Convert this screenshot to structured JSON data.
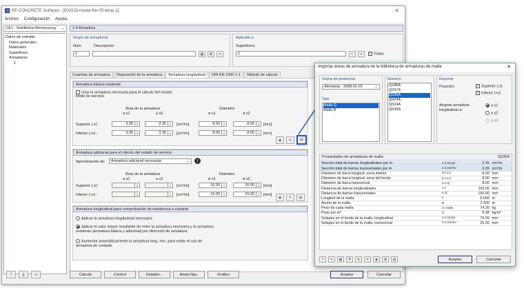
{
  "window": {
    "title": "RF-CONCRETE Surfaces - [001515-model-file-rf5-temp-1]",
    "menu": [
      "Archivo",
      "Configuración",
      "Ayuda"
    ],
    "case": "CA1 - Stahlbeton-Bemessung",
    "section_title": "1.4 Armadura"
  },
  "tree": {
    "root": "Datos de entrada",
    "items": [
      "Datos generales",
      "Materiales",
      "Superficies",
      "Armaduras",
      "1"
    ]
  },
  "groups": {
    "label": "Grupo de armaduras",
    "no_label": "Núm.",
    "desc_label": "Descripción:",
    "no_value": "1",
    "applied_label": "Aplicado a",
    "surfaces_label": "Superficies:",
    "surfaces_value": "1",
    "todas": "Todas"
  },
  "tabs": [
    "Cuantías de armadura",
    "Disposición de la armadura",
    "Armadura longitudinal",
    "DIN EN 1992-1-1",
    "Método de cálculo"
  ],
  "basic": {
    "header": "Armadura básica existente",
    "check_label": "Usar la armadura necesaria para el cálculo del estado límite de servicio",
    "area_header": "Área de la armadura",
    "diam_header": "Diámetro",
    "as1": "a s1",
    "as2": "a s2",
    "fs1": "ø s1",
    "fs2": "ø s2",
    "upper": "Superior (-z) :",
    "lower": "Inferior (+z) :",
    "area_unit": "[cm²/m]",
    "diam_unit": "[mm]",
    "upper_as1": "3.35",
    "upper_as2": "3.35",
    "lower_as1": "3.35",
    "lower_as2": "3.35",
    "upper_d1": "8.00",
    "upper_d2": "8.00",
    "lower_d1": "8.00",
    "lower_d2": "8.00"
  },
  "additional": {
    "header": "Armadura adicional para el cálculo del estado de servicio",
    "approx_label": "Aproximación de:",
    "approx_value": "Armadura adicional necesaria",
    "area_header": "Área de la armadura",
    "diam_header": "Diámetro",
    "as1": "a s1",
    "as2": "a s2",
    "fs1": "ø s1",
    "fs2": "ø s2",
    "upper": "Superior (-z) :",
    "lower": "Inferior (+z) :",
    "area_unit": "[cm²/m]",
    "diam_unit": "[mm]",
    "upper_d1": "16.00",
    "upper_d2": "16.00",
    "lower_d1": "16.00",
    "lower_d2": "16.00"
  },
  "shear": {
    "header": "Armadura longitudinal para comprobación de resistencia a cortante",
    "opt1": "Aplicar la armadura longitudinal necesaria",
    "opt2": "Aplicar el valor mayor resultante de entre la armadura necesaria y la armadura existente (armadura básica y adicional) por dirección de armadura",
    "opt3": "Aumentar automáticamente la armadura long. nec. para evitar el uso de armadura de cortante"
  },
  "bottom": {
    "calc": "Cálculo",
    "control": "Control",
    "details": "Detalles...",
    "annex": "Anejo Nac.",
    "graphic": "Gráfico",
    "accept": "Aceptar",
    "cancel": "Cancelar"
  },
  "dialog": {
    "title": "Importar áreas de armadura de la biblioteca de armaduras de malla",
    "product_label": "Gama de productos",
    "product_value": "Alemania - 2008-01-01",
    "type_label": "Tipo",
    "types": [
      "Malla Q",
      "Malla R"
    ],
    "number_label": "Número",
    "numbers": [
      "Q188A",
      "Q257A",
      "Q335A",
      "Q424A",
      "Q524A",
      "Q636A"
    ],
    "selected_number": "Q335A",
    "export_label": "Exportar",
    "position_label": "Posición:",
    "pos_upper": "Superior (-z)",
    "pos_lower": "Inferior (+z)",
    "assign_label": "Asignar armadura longitudinal a:",
    "as1": "a s1",
    "as2": "a s2",
    "as3": "a s3",
    "props_label": "Propiedades de armaduras de malla",
    "props_id": "Q335A",
    "accept": "Aceptar",
    "cancel": "Cancelar",
    "props": [
      {
        "name": "Sección total de barras longitudinales por m",
        "sym": "a s,longit",
        "val": "3.35",
        "unit": "cm²/m"
      },
      {
        "name": "Sección total de barras transversales por m",
        "sym": "a s,transv",
        "val": "3.35",
        "unit": "cm²/m"
      },
      {
        "name": "Diámetro de barra longitud. zona interior",
        "sym": "ø s,L1",
        "val": "8.00",
        "unit": "mm"
      },
      {
        "name": "Diámetro de barra longitud. zona del borde",
        "sym": "ø s,L2",
        "val": "8.00",
        "unit": "mm"
      },
      {
        "name": "Diámetro de barra transversal",
        "sym": "ø s,Q",
        "val": "8.00",
        "unit": "mm"
      },
      {
        "name": "Distancia de barras longitudinales",
        "sym": "a L",
        "val": "150.00",
        "unit": "mm"
      },
      {
        "name": "Distancia de barras transversales",
        "sym": "a Q",
        "val": "150.00",
        "unit": "mm"
      },
      {
        "name": "Longitud de la malla",
        "sym": "L",
        "val": "6.000",
        "unit": "m"
      },
      {
        "name": "Ancho de la malla",
        "sym": "B",
        "val": "2.300",
        "unit": "m"
      },
      {
        "name": "Peso de cada malla",
        "sym": "G malla",
        "val": "74.30",
        "unit": "kg"
      },
      {
        "name": "Peso por m²",
        "sym": "G",
        "val": "5.38",
        "unit": "kg/m²"
      },
      {
        "name": "Solapes en el borde de la malla. longitudinal",
        "sym": "ü s,longit",
        "val": "75.00",
        "unit": "mm"
      },
      {
        "name": "Solapes en el borde de la malla. transversal",
        "sym": "ü s,transv",
        "val": "25.00",
        "unit": "mm"
      }
    ]
  },
  "colors": {
    "selection": "#1a66c8",
    "header": "#dfe6ee",
    "arrow": "#1f4fd0"
  }
}
